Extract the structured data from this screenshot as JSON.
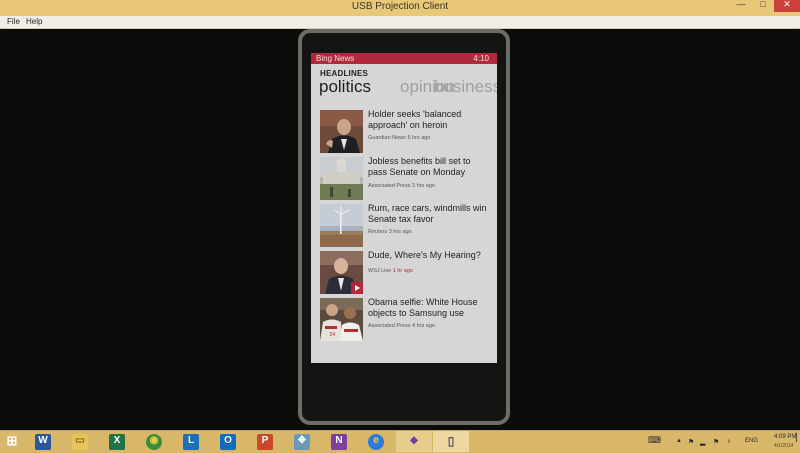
{
  "window": {
    "title": "USB Projection Client",
    "minimize_glyph": "—",
    "maximize_glyph": "□",
    "close_glyph": "✕"
  },
  "menu": [
    "File",
    "Help"
  ],
  "phone": {
    "status": {
      "app": "Bing News",
      "time": "4:10"
    },
    "section": "HEADLINES",
    "pivots": [
      "politics",
      "opinion",
      "business"
    ],
    "articles": [
      {
        "title": "Holder seeks 'balanced approach' on heroin",
        "source": "Guardian News",
        "age": "5 hrs ago"
      },
      {
        "title": "Jobless benefits bill set to pass Senate on Monday",
        "source": "Associated Press",
        "age": "3 hrs ago"
      },
      {
        "title": "Rum, race cars, windmills win Senate tax favor",
        "source": "Reuters",
        "age": "3 hrs ago"
      },
      {
        "title": "Dude, Where's My Hearing?",
        "source": "WSJ Live",
        "age": "1 hr ago"
      },
      {
        "title": "Obama selfie: White House objects to Samsung use",
        "source": "Associated Press",
        "age": "4 hrs ago"
      }
    ]
  },
  "taskbar": {
    "items": [
      {
        "name": "start-button",
        "glyph": "⊞",
        "color": "#d8b66a"
      },
      {
        "name": "word-icon",
        "glyph": "W",
        "color": "#2b579a"
      },
      {
        "name": "file-explorer-icon",
        "glyph": "▭",
        "color": "#e8c35a"
      },
      {
        "name": "excel-icon",
        "glyph": "X",
        "color": "#217346"
      },
      {
        "name": "chrome-icon",
        "glyph": "◉",
        "color": "#3a8d3f"
      },
      {
        "name": "lync-icon",
        "glyph": "L",
        "color": "#1e6fb8"
      },
      {
        "name": "outlook-icon",
        "glyph": "O",
        "color": "#0f6cbd"
      },
      {
        "name": "powerpoint-icon",
        "glyph": "P",
        "color": "#c9472b"
      },
      {
        "name": "hub-app-icon",
        "glyph": "✥",
        "color": "#6b9ab8"
      },
      {
        "name": "onenote-icon",
        "glyph": "N",
        "color": "#7b3fa0"
      },
      {
        "name": "internet-explorer-icon",
        "glyph": "e",
        "color": "#2c7bd6"
      },
      {
        "name": "visual-studio-icon",
        "glyph": "◆",
        "color": "#6f3fa9"
      },
      {
        "name": "phone-projection-icon",
        "glyph": "▯",
        "color": "#555555"
      }
    ],
    "tray": {
      "keyboard_glyph": "⌨",
      "up_glyph": "▲",
      "flag_glyph": "⚑",
      "network_glyph": "▂",
      "volume_glyph": "♪",
      "lang": "ENG",
      "time": "4:09 PM",
      "date": "4/1/2014",
      "desktop_glyph": "▏"
    }
  }
}
